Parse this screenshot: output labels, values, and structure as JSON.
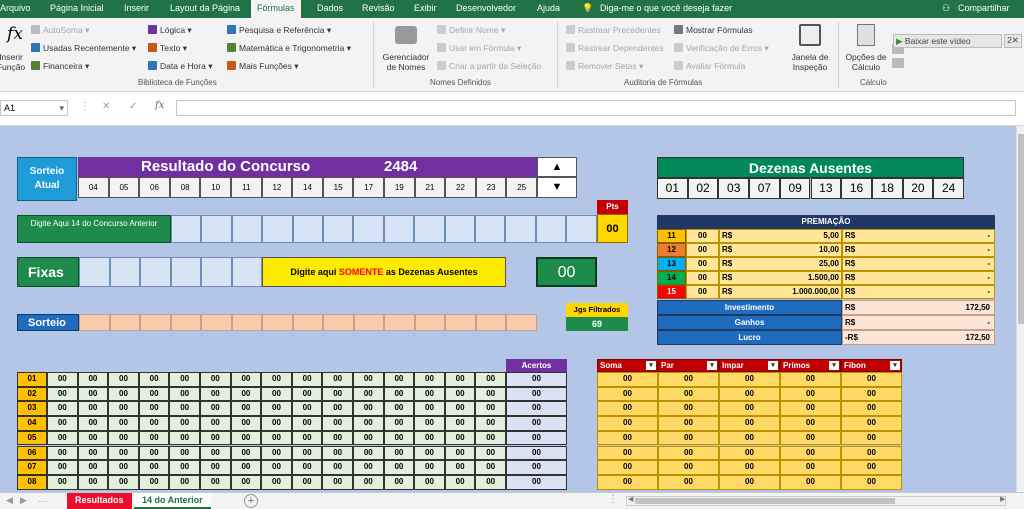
{
  "menu": {
    "tabs": [
      "Arquivo",
      "Página Inicial",
      "Inserir",
      "Layout da Página",
      "Fórmulas",
      "Dados",
      "Revisão",
      "Exibir",
      "Desenvolvedor",
      "Ajuda"
    ],
    "tell_me": "Diga-me o que você deseja fazer",
    "share": "Compartilhar"
  },
  "ribbon": {
    "insert_function": "Inserir Função",
    "fx": "fx",
    "lib": [
      "AutoSoma",
      "Usadas Recentemente",
      "Financeira",
      "Lógica",
      "Texto",
      "Data e Hora",
      "Pesquisa e Referência",
      "Matemática e Trigonometria",
      "Mais Funções"
    ],
    "lib_group": "Biblioteca de Funções",
    "names_manager": "Gerenciador de Nomes",
    "names": [
      "Definir Nome",
      "Usar em Fórmula",
      "Criar a partir da Seleção"
    ],
    "names_group": "Nomes Definidos",
    "audit": [
      "Rastrear Precedentes",
      "Rastrear Dependentes",
      "Remover Setas",
      "Mostrar Fórmulas",
      "Verificação de Erros",
      "Avaliar Fórmula"
    ],
    "audit_group": "Auditoria de Fórmulas",
    "watch": "Janela de Inspeção",
    "calc_options": "Opções de Cálculo",
    "calc_group": "Cálculo",
    "download_video": "Baixar este vídeo",
    "close_x": "2"
  },
  "formula_bar": {
    "namebox": "A1",
    "fx": "fx"
  },
  "sheet": {
    "sorteio_atual": "Sorteio Atual",
    "resultado_title": "Resultado do Concurso",
    "concurso": "2484",
    "resultado_nums": [
      "04",
      "05",
      "06",
      "08",
      "10",
      "11",
      "12",
      "14",
      "15",
      "17",
      "19",
      "21",
      "22",
      "23",
      "25"
    ],
    "dezenas_title": "Dezenas Ausentes",
    "dezenas": [
      "01",
      "02",
      "03",
      "07",
      "09",
      "13",
      "16",
      "18",
      "20",
      "24"
    ],
    "digite14": "Digite Aqui 14 do Concurso Anterior",
    "pts_label": "Pts",
    "pts_value": "00",
    "premiacao_title": "PREMIAÇÃO",
    "premiacao": [
      {
        "n": "11",
        "q": "00",
        "rs": "R$",
        "v": "5,00",
        "rs2": "R$",
        "t": "-",
        "c": "#ffc000"
      },
      {
        "n": "12",
        "q": "00",
        "rs": "R$",
        "v": "10,00",
        "rs2": "R$",
        "t": "-",
        "c": "#ed7d31"
      },
      {
        "n": "13",
        "q": "00",
        "rs": "R$",
        "v": "25,00",
        "rs2": "R$",
        "t": "-",
        "c": "#00b0f0"
      },
      {
        "n": "14",
        "q": "00",
        "rs": "R$",
        "v": "1.500,00",
        "rs2": "R$",
        "t": "-",
        "c": "#00b050"
      },
      {
        "n": "15",
        "q": "00",
        "rs": "R$",
        "v": "1.000.000,00",
        "rs2": "R$",
        "t": "-",
        "c": "#ff0000"
      }
    ],
    "investimento_label": "Investimento",
    "investimento_rs": "R$",
    "investimento": "172,50",
    "ganhos_label": "Ganhos",
    "ganhos_rs": "R$",
    "ganhos": "-",
    "lucro_label": "Lucro",
    "lucro_rs": "-R$",
    "lucro": "172,50",
    "fixas": "Fixas",
    "digite_ausentes_pre": "Digite aqui ",
    "digite_ausentes_mid": "SOMENTE",
    "digite_ausentes_post": " as Dezenas Ausentes",
    "fixas_count": "00",
    "jgs_label": "Jgs Filtrados",
    "jgs_value": "69",
    "sorteio": "Sorteio",
    "acertos": "Acertos",
    "stats_headers": [
      "Soma",
      "Par",
      "Impar",
      "Primos",
      "Fibon"
    ],
    "rows": [
      "01",
      "02",
      "03",
      "04",
      "05",
      "06",
      "07",
      "08"
    ],
    "cell_value": "00"
  },
  "sheet_tabs": [
    "Resultados",
    "14 do Anterior"
  ]
}
